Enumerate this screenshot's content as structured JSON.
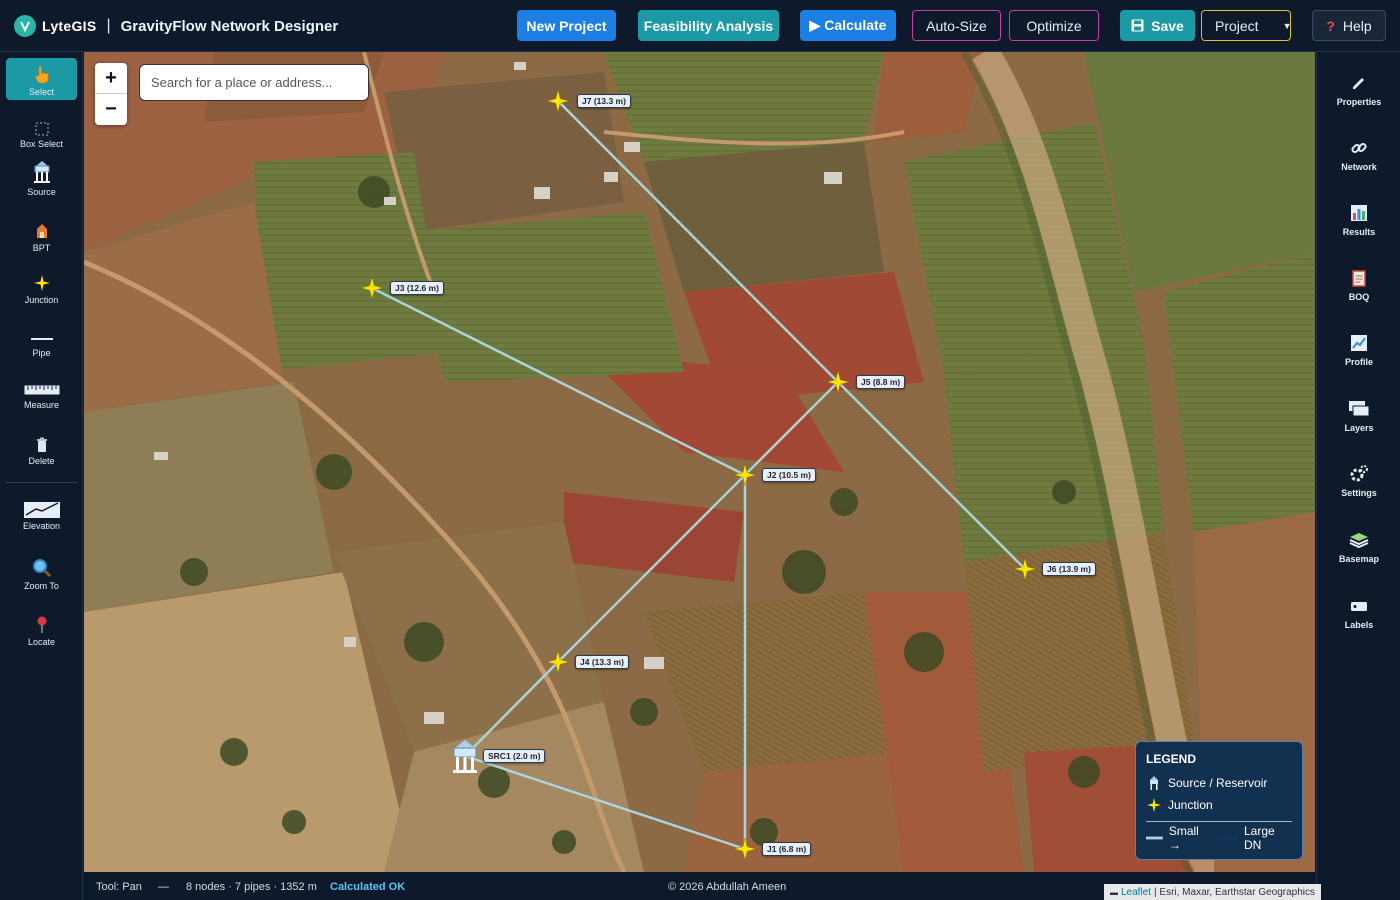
{
  "header": {
    "logo_text": "LyteGIS",
    "separator": "|",
    "app_title": "GravityFlow Network Designer",
    "buttons": {
      "new_project": "New Project",
      "feasibility": "Feasibility Analysis",
      "calculate": "▶ Calculate",
      "auto_size": "Auto-Size",
      "optimize": "Optimize",
      "save": "Save",
      "project": "Project",
      "help": "Help"
    }
  },
  "left_toolbar": {
    "select": "Select",
    "box_select": "Box Select",
    "source": "Source",
    "bpt": "BPT",
    "junction": "Junction",
    "pipe": "Pipe",
    "measure": "Measure",
    "delete": "Delete",
    "elevation": "Elevation",
    "zoom_to": "Zoom To",
    "locate": "Locate"
  },
  "right_toolbar": {
    "properties": "Properties",
    "network": "Network",
    "results": "Results",
    "boq": "BOQ",
    "profile": "Profile",
    "layers": "Layers",
    "settings": "Settings",
    "basemap": "Basemap",
    "labels": "Labels"
  },
  "map": {
    "zoom_in": "+",
    "zoom_out": "−",
    "search_placeholder": "Search for a place or address...",
    "nodes": {
      "J7": "J7 (13.3 m)",
      "J3": "J3 (12.6 m)",
      "J5": "J5 (8.8 m)",
      "J2": "J2 (10.5 m)",
      "J6": "J6 (13.9 m)",
      "J4": "J4 (13.3 m)",
      "SRC1": "SRC1 (2.0 m)",
      "J1": "J1 (6.8 m)"
    },
    "colors": {
      "pipe": "#a9d4dc",
      "junction": "#ffe600"
    }
  },
  "legend": {
    "title": "LEGEND",
    "source": "Source / Reservoir",
    "junction": "Junction",
    "small": "Small →",
    "large": "Large DN"
  },
  "status": {
    "tool": "Tool: Pan",
    "dash": "—",
    "counts": "8 nodes · 7 pipes · 1352 m",
    "calc": "Calculated OK",
    "copyright": "© 2026 Abdullah Ameen"
  },
  "attribution": {
    "leaflet": "Leaflet",
    "rest": "| Esri, Maxar, Earthstar Geographics"
  }
}
